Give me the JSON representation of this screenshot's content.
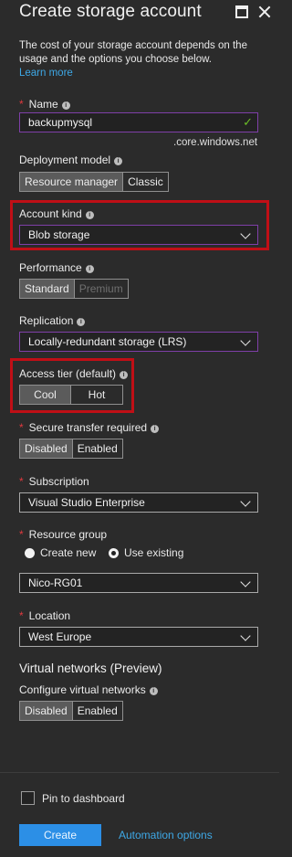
{
  "title": "Create storage account",
  "description": "The cost of your storage account depends on the usage and the options you choose below.",
  "learn_more": "Learn more",
  "name": {
    "label": "Name",
    "value": "backupmysql",
    "suffix": ".core.windows.net"
  },
  "deployment_model": {
    "label": "Deployment model",
    "options": [
      "Resource manager",
      "Classic"
    ],
    "selected": "Resource manager"
  },
  "account_kind": {
    "label": "Account kind",
    "value": "Blob storage"
  },
  "performance": {
    "label": "Performance",
    "options": [
      "Standard",
      "Premium"
    ],
    "selected": "Standard"
  },
  "replication": {
    "label": "Replication",
    "value": "Locally-redundant storage (LRS)"
  },
  "access_tier": {
    "label": "Access tier (default)",
    "options": [
      "Cool",
      "Hot"
    ],
    "selected": "Cool"
  },
  "secure_transfer": {
    "label": "Secure transfer required",
    "options": [
      "Disabled",
      "Enabled"
    ],
    "selected": "Disabled"
  },
  "subscription": {
    "label": "Subscription",
    "value": "Visual Studio Enterprise"
  },
  "resource_group": {
    "label": "Resource group",
    "create_new": "Create new",
    "use_existing": "Use existing",
    "selected_mode": "Use existing",
    "value": "Nico-RG01"
  },
  "location": {
    "label": "Location",
    "value": "West Europe"
  },
  "virtual_networks": {
    "heading": "Virtual networks (Preview)",
    "label": "Configure virtual networks",
    "options": [
      "Disabled",
      "Enabled"
    ],
    "selected": "Disabled"
  },
  "footer": {
    "pin_label": "Pin to dashboard",
    "create_label": "Create",
    "automation_label": "Automation options"
  },
  "colors": {
    "accent": "#2c8fe6",
    "highlight": "#c00f16",
    "required": "#e0393e",
    "link": "#3ea8e6"
  }
}
